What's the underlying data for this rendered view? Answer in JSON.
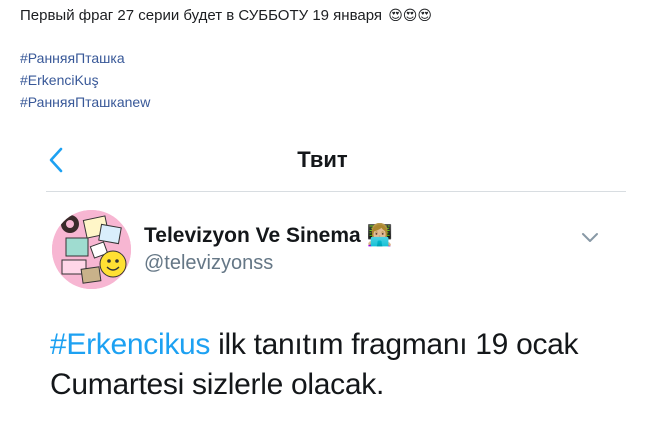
{
  "post": {
    "text": "Первый фраг 27 серии будет в СУББОТУ 19 января",
    "emoji": "😍😍😍",
    "hashtags": [
      "#РанняяПташка",
      "#ErkenciKuş",
      "#РанняяПташкаnew"
    ]
  },
  "tweet_screenshot": {
    "nav": {
      "back_icon": "chevron-left",
      "title": "Твит"
    },
    "author": {
      "name": "Televizyon Ve Sinema",
      "badge_emoji": "👩🏼‍💻",
      "handle": "@televizyonss"
    },
    "menu_icon": "chevron-down",
    "body": {
      "hashtag": "#Erkencikus",
      "text": " ilk tanıtım fragmanı 19 ocak Cumartesi sizlerle olacak."
    }
  },
  "colors": {
    "link": "#385898",
    "twitter_blue": "#1da1f2",
    "handle_gray": "#657786"
  }
}
